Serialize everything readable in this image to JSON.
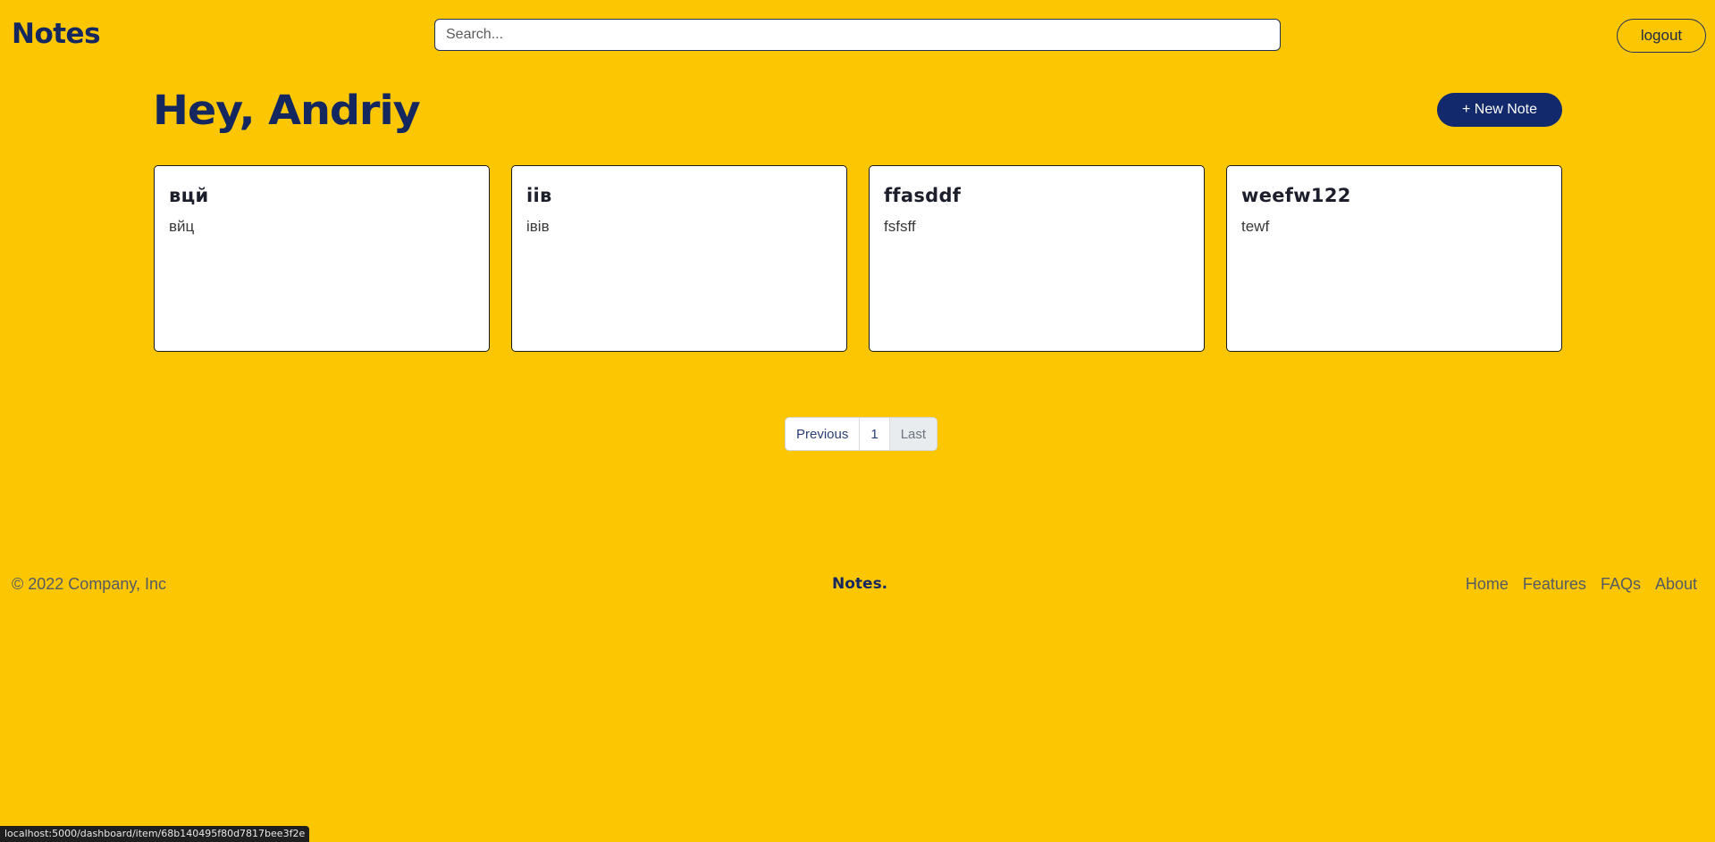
{
  "header": {
    "brand": "Notes",
    "search_placeholder": "Search...",
    "search_value": "",
    "logout_label": "logout"
  },
  "main": {
    "greeting": "Hey, Andriy",
    "new_note_label": "+ New Note",
    "notes": [
      {
        "title": "вцй",
        "body": "вйц"
      },
      {
        "title": "iiв",
        "body": "iвiв"
      },
      {
        "title": "ffasddf",
        "body": "fsfsff"
      },
      {
        "title": "weefw122",
        "body": "tewf"
      }
    ]
  },
  "pagination": {
    "previous": "Previous",
    "page": "1",
    "last": "Last"
  },
  "footer": {
    "copyright": "© 2022 Company, Inc",
    "brand": "Notes.",
    "links": [
      "Home",
      "Features",
      "FAQs",
      "About"
    ]
  },
  "status_bar": {
    "url": "localhost:5000/dashboard/item/68b140495f80d7817bee3f2e"
  },
  "colors": {
    "background": "#fcc603",
    "primary": "#14275f",
    "button": "#12296b"
  }
}
